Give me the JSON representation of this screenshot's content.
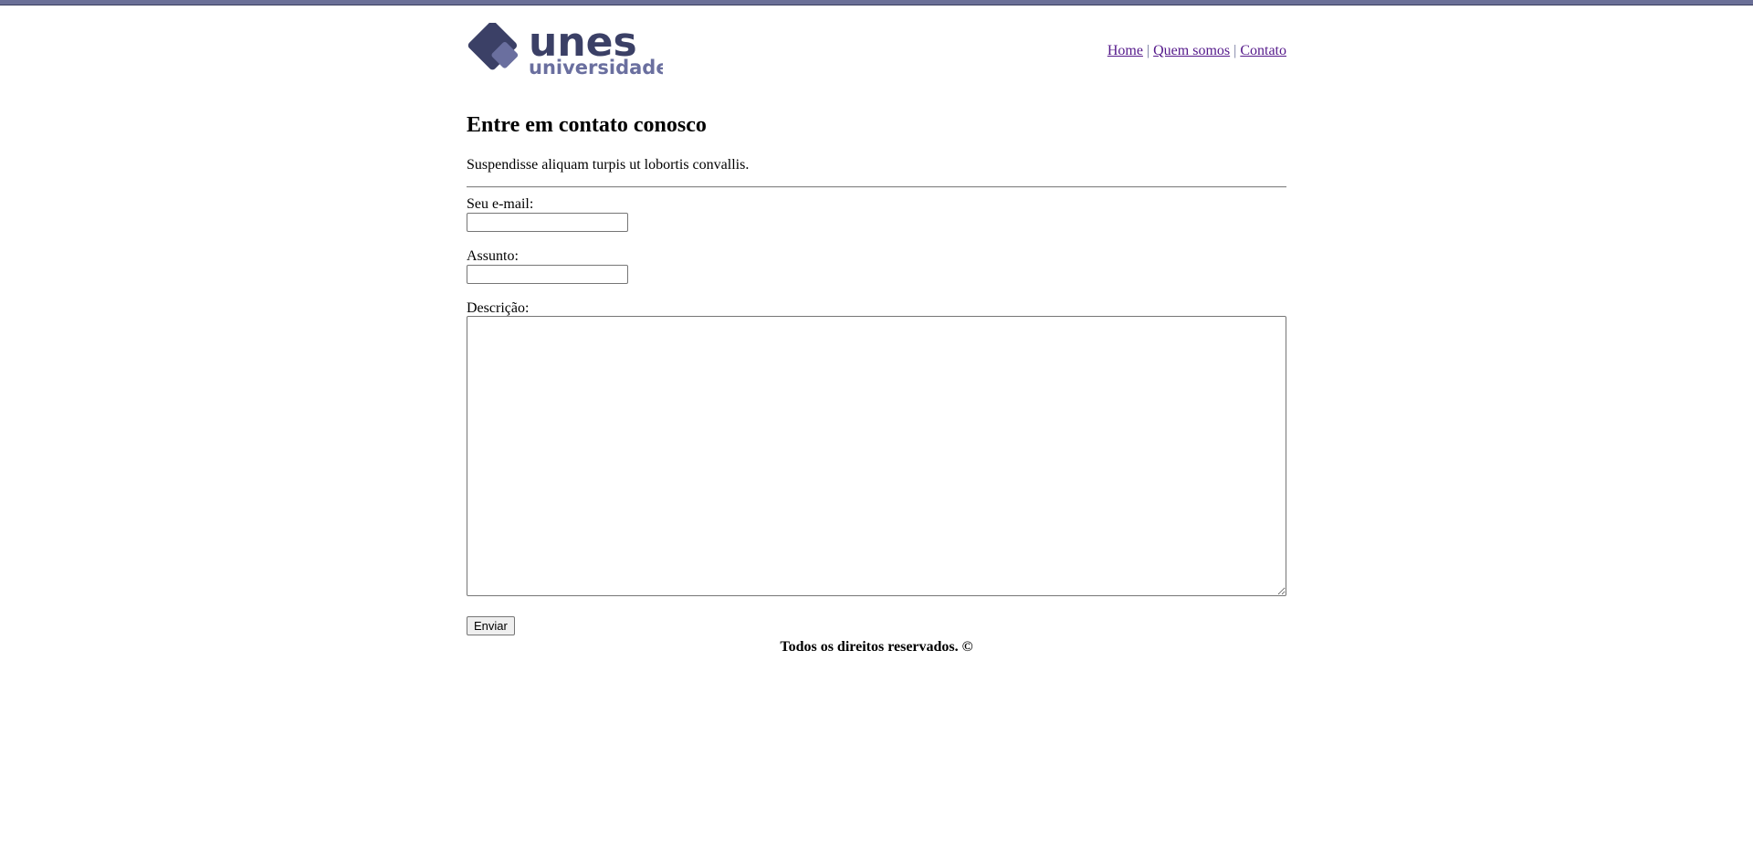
{
  "colors": {
    "top_bar": "#6a6f97",
    "logo_dark": "#3b4066",
    "logo_light": "#6a6f9f",
    "link": "#551a8b"
  },
  "logo": {
    "name": "unes",
    "tagline": "universidade",
    "icon": "diamond-logo-icon"
  },
  "nav": {
    "items": [
      {
        "label": "Home"
      },
      {
        "label": "Quem somos"
      },
      {
        "label": "Contato"
      }
    ],
    "separator": "|"
  },
  "page": {
    "title": "Entre em contato conosco",
    "intro": "Suspendisse aliquam turpis ut lobortis convallis."
  },
  "form": {
    "email_label": "Seu e-mail:",
    "email_value": "",
    "subject_label": "Assunto:",
    "subject_value": "",
    "description_label": "Descrição:",
    "description_value": "",
    "submit_label": "Enviar"
  },
  "footer": {
    "text": "Todos os direitos reservados. ©"
  }
}
